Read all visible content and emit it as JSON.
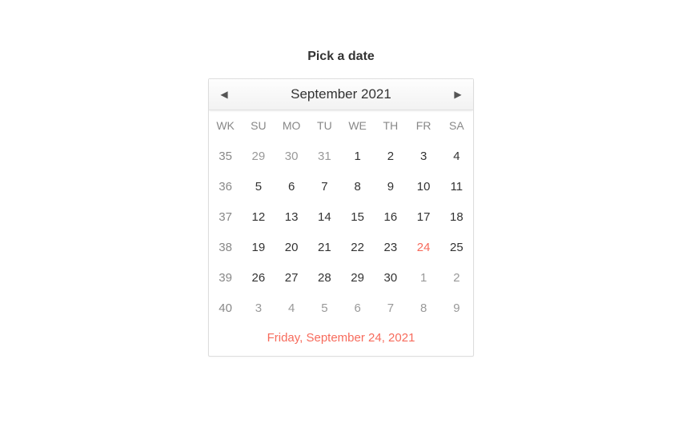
{
  "title": "Pick a date",
  "accentColor": "#f76b5c",
  "header": {
    "monthLabel": "September 2021"
  },
  "dayHeaders": [
    "WK",
    "SU",
    "MO",
    "TU",
    "WE",
    "TH",
    "FR",
    "SA"
  ],
  "rows": [
    {
      "wk": 35,
      "days": [
        {
          "n": 29,
          "other": true
        },
        {
          "n": 30,
          "other": true
        },
        {
          "n": 31,
          "other": true
        },
        {
          "n": 1
        },
        {
          "n": 2
        },
        {
          "n": 3
        },
        {
          "n": 4
        }
      ]
    },
    {
      "wk": 36,
      "days": [
        {
          "n": 5
        },
        {
          "n": 6
        },
        {
          "n": 7
        },
        {
          "n": 8
        },
        {
          "n": 9
        },
        {
          "n": 10
        },
        {
          "n": 11
        }
      ]
    },
    {
      "wk": 37,
      "days": [
        {
          "n": 12
        },
        {
          "n": 13
        },
        {
          "n": 14
        },
        {
          "n": 15
        },
        {
          "n": 16
        },
        {
          "n": 17
        },
        {
          "n": 18
        }
      ]
    },
    {
      "wk": 38,
      "days": [
        {
          "n": 19
        },
        {
          "n": 20
        },
        {
          "n": 21
        },
        {
          "n": 22
        },
        {
          "n": 23
        },
        {
          "n": 24,
          "today": true
        },
        {
          "n": 25
        }
      ]
    },
    {
      "wk": 39,
      "days": [
        {
          "n": 26
        },
        {
          "n": 27
        },
        {
          "n": 28
        },
        {
          "n": 29
        },
        {
          "n": 30
        },
        {
          "n": 1,
          "other": true
        },
        {
          "n": 2,
          "other": true
        }
      ]
    },
    {
      "wk": 40,
      "days": [
        {
          "n": 3,
          "other": true
        },
        {
          "n": 4,
          "other": true
        },
        {
          "n": 5,
          "other": true
        },
        {
          "n": 6,
          "other": true
        },
        {
          "n": 7,
          "other": true
        },
        {
          "n": 8,
          "other": true
        },
        {
          "n": 9,
          "other": true
        }
      ]
    }
  ],
  "selectedLabel": "Friday, September 24, 2021"
}
